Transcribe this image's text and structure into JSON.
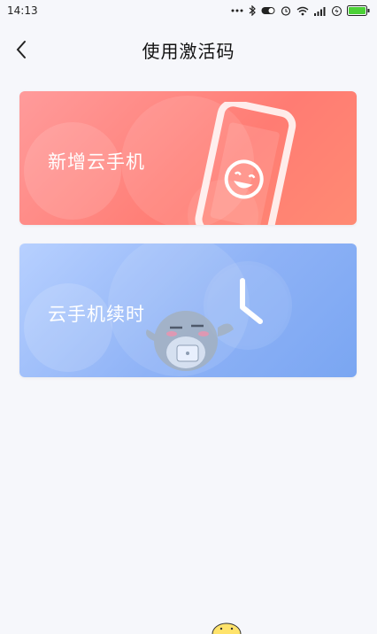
{
  "status_bar": {
    "time": "14:13",
    "icons": [
      "more-dots-icon",
      "bluetooth-icon",
      "toggle-icon",
      "alarm-icon",
      "wifi-icon",
      "signal-icon",
      "charging-icon",
      "battery-icon"
    ]
  },
  "header": {
    "title": "使用激活码",
    "back_icon": "chevron-left-icon"
  },
  "cards": [
    {
      "label": "新增云手机",
      "icon": "smiling-phone-icon",
      "gradient": [
        "#ff9b9b",
        "#ff7c73"
      ]
    },
    {
      "label": "云手机续时",
      "icon": "clock-icon",
      "gradient": [
        "#b7d0ff",
        "#7aa6f2"
      ]
    }
  ],
  "colors": {
    "battery": "#4cd137",
    "background": "#f6f7fb"
  }
}
